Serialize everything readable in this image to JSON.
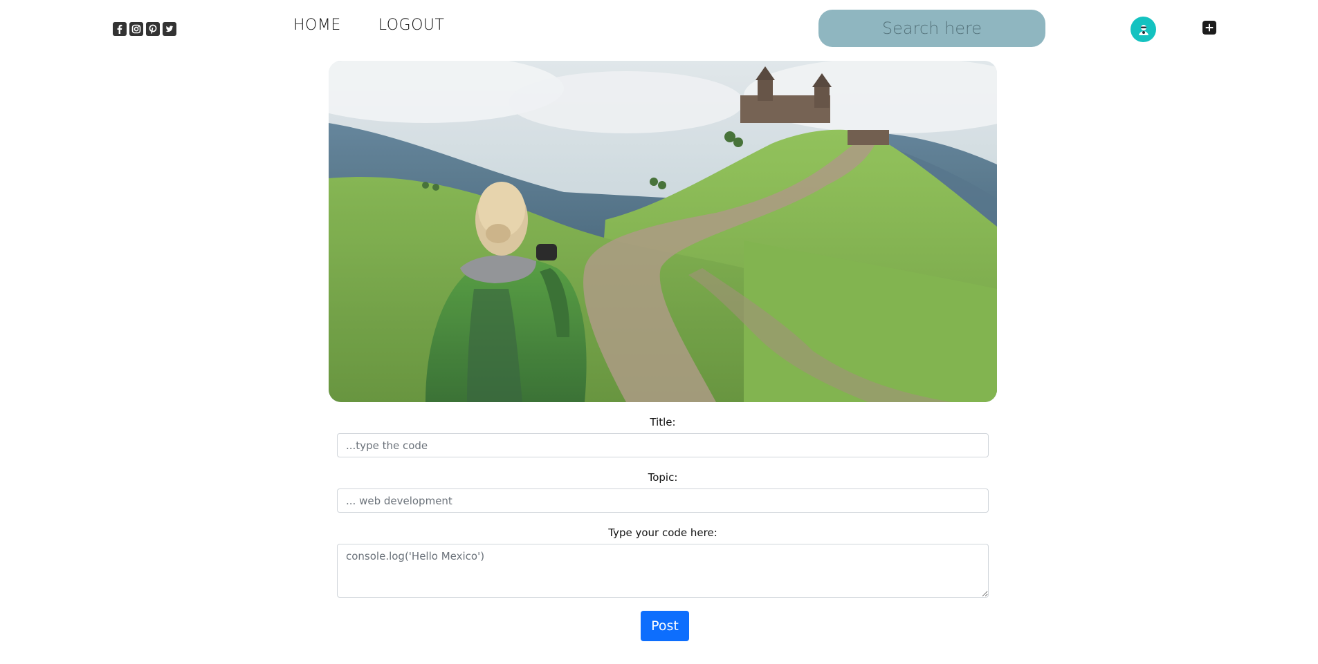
{
  "header": {
    "social_icons": [
      "facebook-icon",
      "instagram-icon",
      "pinterest-icon",
      "twitter-icon"
    ],
    "nav": [
      {
        "label": "HOME"
      },
      {
        "label": "LOGOUT"
      }
    ],
    "search": {
      "placeholder": "Search here"
    },
    "accent_color": "#14c2c0",
    "search_bg_color": "#8fb6c0"
  },
  "hero": {
    "image": "landscape photo of a hiker with camera looking at a hilltop church"
  },
  "form": {
    "title_label": "Title:",
    "title_placeholder": "...type the code",
    "topic_label": "Topic:",
    "topic_placeholder": "... web development",
    "code_label": "Type your code here:",
    "code_placeholder": "console.log('Hello Mexico')",
    "post_label": "Post",
    "post_color": "#0d6efd"
  }
}
